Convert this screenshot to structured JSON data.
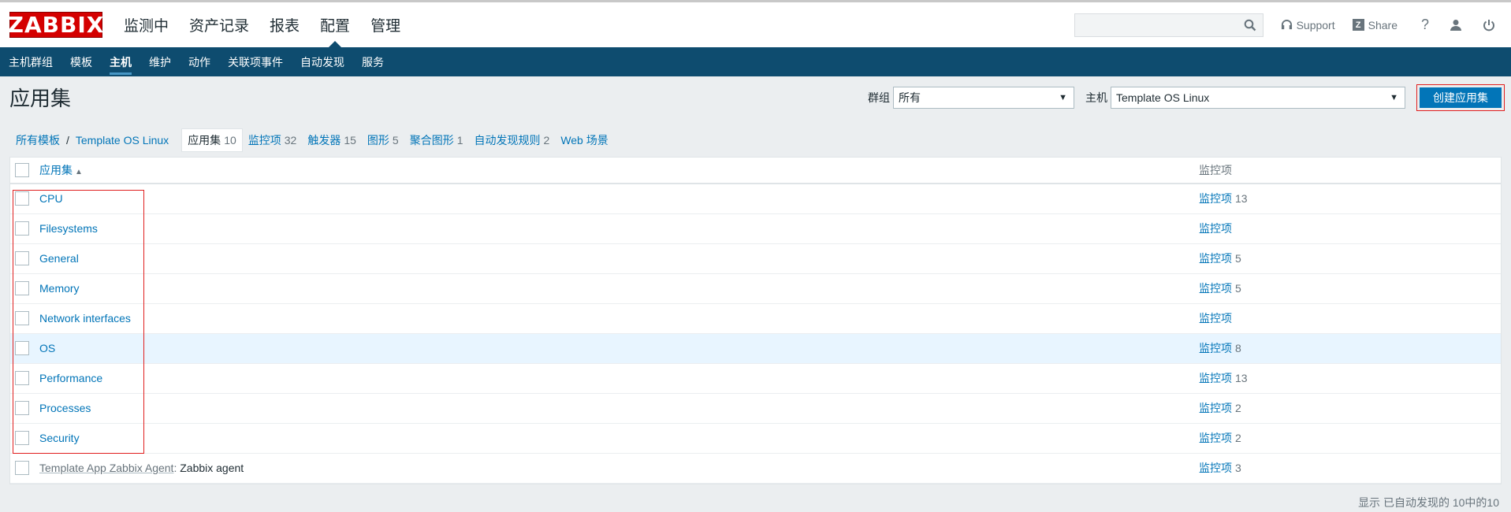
{
  "header": {
    "logo_text": "ZABBIX",
    "nav": [
      {
        "label": "监测中"
      },
      {
        "label": "资产记录"
      },
      {
        "label": "报表"
      },
      {
        "label": "配置"
      },
      {
        "label": "管理"
      }
    ],
    "search_placeholder": "",
    "support_label": "Support",
    "share_label": "Share",
    "share_badge": "Z",
    "help_label": "?"
  },
  "subnav": [
    {
      "label": "主机群组"
    },
    {
      "label": "模板"
    },
    {
      "label": "主机"
    },
    {
      "label": "维护"
    },
    {
      "label": "动作"
    },
    {
      "label": "关联项事件"
    },
    {
      "label": "自动发现"
    },
    {
      "label": "服务"
    }
  ],
  "page": {
    "title": "应用集",
    "group_label": "群组",
    "group_value": "所有",
    "host_label": "主机",
    "host_value": "Template OS Linux",
    "create_button": "创建应用集"
  },
  "breadcrumb": {
    "all_templates": "所有模板",
    "separator": "/",
    "template": "Template OS Linux",
    "tabs": [
      {
        "label": "应用集",
        "count": "10"
      },
      {
        "label": "监控项",
        "count": "32"
      },
      {
        "label": "触发器",
        "count": "15"
      },
      {
        "label": "图形",
        "count": "5"
      },
      {
        "label": "聚合图形",
        "count": "1"
      },
      {
        "label": "自动发现规则",
        "count": "2"
      },
      {
        "label": "Web 场景",
        "count": ""
      }
    ]
  },
  "table": {
    "col_app": "应用集",
    "col_app_sort": "▲",
    "col_items": "监控项",
    "rows": [
      {
        "prefix": "",
        "name": "CPU",
        "items": "监控项",
        "count": "13"
      },
      {
        "prefix": "",
        "name": "Filesystems",
        "items": "监控项",
        "count": ""
      },
      {
        "prefix": "",
        "name": "General",
        "items": "监控项",
        "count": "5"
      },
      {
        "prefix": "",
        "name": "Memory",
        "items": "监控项",
        "count": "5"
      },
      {
        "prefix": "",
        "name": "Network interfaces",
        "items": "监控项",
        "count": ""
      },
      {
        "prefix": "",
        "name": "OS",
        "items": "监控项",
        "count": "8"
      },
      {
        "prefix": "",
        "name": "Performance",
        "items": "监控项",
        "count": "13"
      },
      {
        "prefix": "",
        "name": "Processes",
        "items": "监控项",
        "count": "2"
      },
      {
        "prefix": "",
        "name": "Security",
        "items": "监控项",
        "count": "2"
      },
      {
        "prefix": "Template App Zabbix Agent",
        "name": "Zabbix agent",
        "items": "监控项",
        "count": "3"
      }
    ]
  },
  "footer": {
    "stats": "显示 已自动发现的 10中的10"
  }
}
